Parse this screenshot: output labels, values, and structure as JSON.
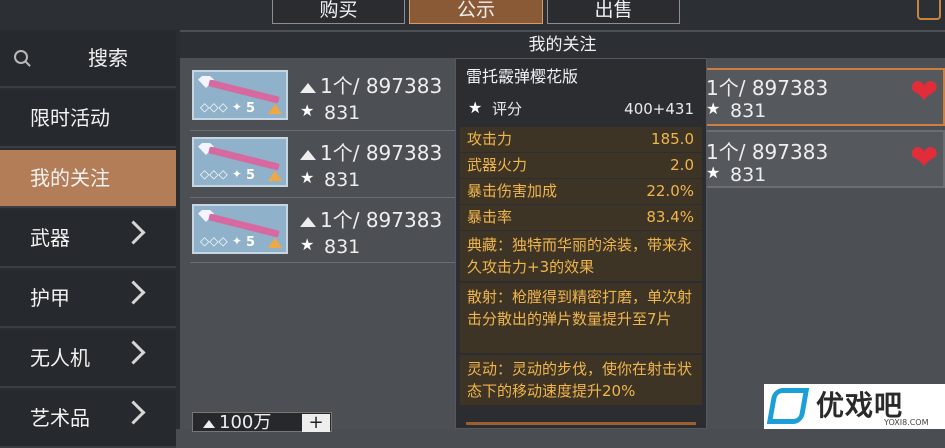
{
  "tabs": {
    "buy": "购买",
    "notice": "公示",
    "sell": "出售"
  },
  "sidebar": {
    "items": [
      {
        "label": "搜索"
      },
      {
        "label": "限时活动"
      },
      {
        "label": "我的关注"
      },
      {
        "label": "武器"
      },
      {
        "label": "护甲"
      },
      {
        "label": "无人机"
      },
      {
        "label": "艺术品"
      }
    ]
  },
  "section_title": "我的关注",
  "listings": [
    {
      "price": "1个/ 897383",
      "score": "831",
      "level": "5"
    },
    {
      "price": "1个/ 897383",
      "score": "831",
      "level": "5"
    },
    {
      "price": "1个/ 897383",
      "score": "831",
      "level": "5"
    }
  ],
  "right_listings": [
    {
      "price": "1个/ 897383",
      "score": "831"
    },
    {
      "price": "1个/ 897383",
      "score": "831"
    }
  ],
  "money": {
    "amount": "100万"
  },
  "tooltip": {
    "name": "雷托霰弹樱花版",
    "score_label": "评分",
    "score_value": "400+431",
    "stats": [
      {
        "key": "攻击力",
        "value": "185.0"
      },
      {
        "key": "武器火力",
        "value": "2.0"
      },
      {
        "key": "暴击伤害加成",
        "value": "22.0%"
      },
      {
        "key": "暴击率",
        "value": "83.4%"
      }
    ],
    "desc1": "典藏：独特而华丽的涂装，带来永久攻击力+3的效果",
    "desc2": "散射：枪膛得到精密打磨，单次射击分散出的弹片数量提升至7片",
    "desc3": "灵动：灵动的步伐，使你在射击状态下的移动速度提升20%"
  },
  "watermark": {
    "text": "优戏吧",
    "url": "YOXI8.COM"
  },
  "colors": {
    "accent": "#b27d57",
    "stat_text": "#f0b54c",
    "heart": "#e22c3a"
  }
}
